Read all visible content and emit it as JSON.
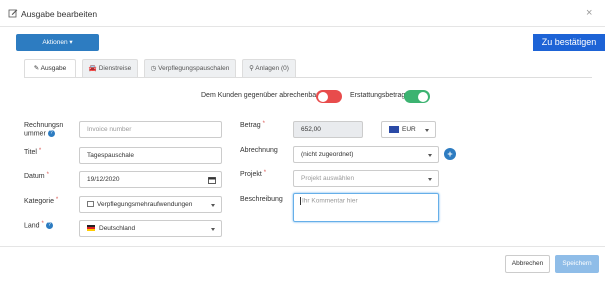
{
  "dialog": {
    "title": "Ausgabe bearbeiten",
    "close": "×"
  },
  "toolbar": {
    "actions_label": "Aktionen ▾",
    "confirm_label": "Zu bestätigen"
  },
  "tabs": [
    {
      "label": "Ausgabe",
      "icon": "pencil-icon"
    },
    {
      "label": "Dienstreise",
      "icon": "car-icon"
    },
    {
      "label": "Verpflegungspauschalen",
      "icon": "clock-icon"
    },
    {
      "label": "Anlagen (0)",
      "icon": "paperclip-icon"
    }
  ],
  "toggles": {
    "bill_customer_label": "Dem Kunden gegenüber abrechenbar",
    "bill_customer_on": false,
    "reimbursement_label": "Erstattungsbetrag",
    "reimbursement_on": true,
    "off_color": "#e84c4c",
    "on_color": "#3cb371"
  },
  "form": {
    "invoice_label_1": "Rechnungsn",
    "invoice_label_2": "ummer",
    "invoice_placeholder": "Invoice number",
    "title_label": "Titel",
    "title_value": "Tagespauschale",
    "date_label": "Datum",
    "date_value": "19/12/2020",
    "category_label": "Kategorie",
    "category_value": "Verpflegungsmehraufwendungen",
    "country_label": "Land",
    "country_value": "Deutschland",
    "amount_label": "Betrag",
    "amount_value": "652,00",
    "currency_value": "EUR",
    "billing_label": "Abrechnung",
    "billing_value": "(nicht zugeordnet)",
    "project_label": "Projekt",
    "project_placeholder": "Projekt auswählen",
    "description_label": "Beschreibung",
    "description_placeholder": "Ihr Kommentar hier",
    "required_mark": "*",
    "help_mark": "?"
  },
  "footer": {
    "cancel_label": "Abbrechen",
    "save_label": "Speichern"
  }
}
